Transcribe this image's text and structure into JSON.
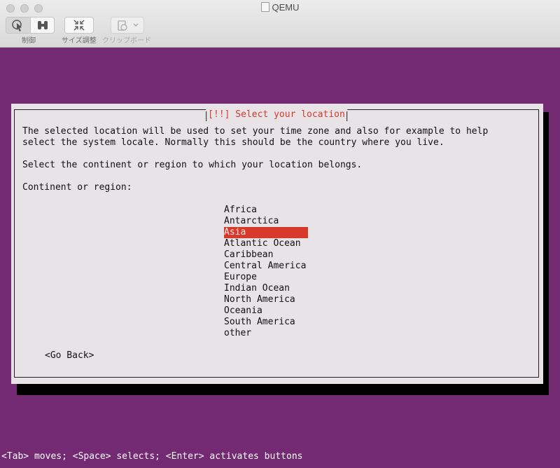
{
  "window": {
    "title": "QEMU",
    "toolbar": {
      "control_label": "制御",
      "resize_label": "サイズ調整",
      "clipboard_label": "クリップボード"
    }
  },
  "dialog": {
    "title": "[!!] Select your location",
    "description_line1": "The selected location will be used to set your time zone and also for example to help",
    "description_line2": "select the system locale. Normally this should be the country where you live.",
    "prompt": "Select the continent or region to which your location belongs.",
    "field_label": "Continent or region:",
    "options": [
      {
        "label": "Africa"
      },
      {
        "label": "Antarctica"
      },
      {
        "label": "Asia"
      },
      {
        "label": "Atlantic Ocean"
      },
      {
        "label": "Caribbean"
      },
      {
        "label": "Central America"
      },
      {
        "label": "Europe"
      },
      {
        "label": "Indian Ocean"
      },
      {
        "label": "North America"
      },
      {
        "label": "Oceania"
      },
      {
        "label": "South America"
      },
      {
        "label": "other"
      }
    ],
    "selected_option": "Asia",
    "go_back_label": "<Go Back>"
  },
  "help_line": "<Tab> moves; <Space> selects; <Enter> activates buttons",
  "colors": {
    "background": "#732a73",
    "dialog_bg": "#e7e3e7",
    "accent_red": "#d73a2a"
  }
}
